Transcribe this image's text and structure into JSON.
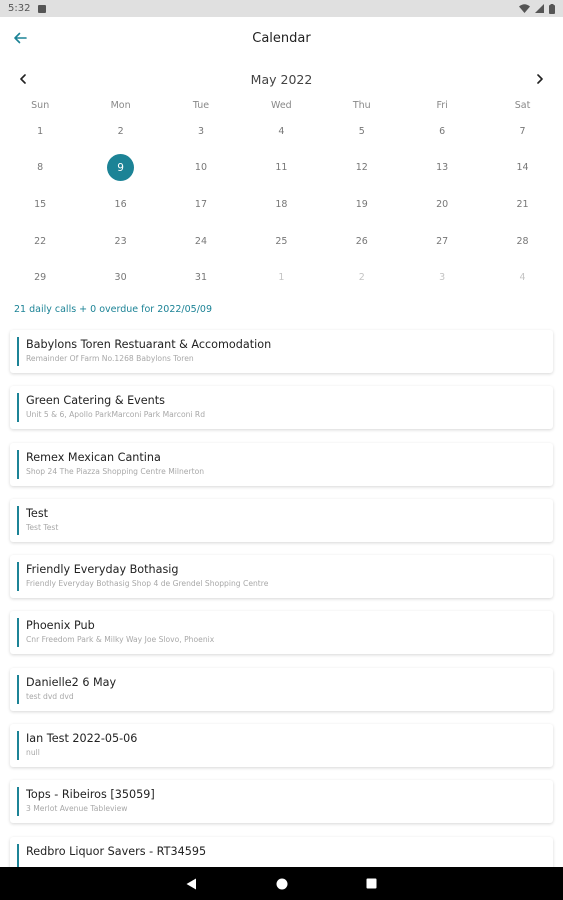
{
  "status_bar": {
    "time": "5:32"
  },
  "header": {
    "title": "Calendar"
  },
  "calendar": {
    "month_label": "May 2022",
    "weekdays": [
      "Sun",
      "Mon",
      "Tue",
      "Wed",
      "Thu",
      "Fri",
      "Sat"
    ],
    "days": [
      {
        "label": "1",
        "current": true
      },
      {
        "label": "2",
        "current": true
      },
      {
        "label": "3",
        "current": true
      },
      {
        "label": "4",
        "current": true
      },
      {
        "label": "5",
        "current": true
      },
      {
        "label": "6",
        "current": true
      },
      {
        "label": "7",
        "current": true
      },
      {
        "label": "8",
        "current": true
      },
      {
        "label": "9",
        "current": true,
        "selected": true
      },
      {
        "label": "10",
        "current": true
      },
      {
        "label": "11",
        "current": true
      },
      {
        "label": "12",
        "current": true
      },
      {
        "label": "13",
        "current": true
      },
      {
        "label": "14",
        "current": true
      },
      {
        "label": "15",
        "current": true
      },
      {
        "label": "16",
        "current": true
      },
      {
        "label": "17",
        "current": true
      },
      {
        "label": "18",
        "current": true
      },
      {
        "label": "19",
        "current": true
      },
      {
        "label": "20",
        "current": true
      },
      {
        "label": "21",
        "current": true
      },
      {
        "label": "22",
        "current": true
      },
      {
        "label": "23",
        "current": true
      },
      {
        "label": "24",
        "current": true
      },
      {
        "label": "25",
        "current": true
      },
      {
        "label": "26",
        "current": true
      },
      {
        "label": "27",
        "current": true
      },
      {
        "label": "28",
        "current": true
      },
      {
        "label": "29",
        "current": true
      },
      {
        "label": "30",
        "current": true
      },
      {
        "label": "31",
        "current": true
      },
      {
        "label": "1",
        "current": false
      },
      {
        "label": "2",
        "current": false
      },
      {
        "label": "3",
        "current": false
      },
      {
        "label": "4",
        "current": false
      }
    ]
  },
  "summary": {
    "text": "21 daily calls + 0 overdue for 2022/05/09"
  },
  "calls": [
    {
      "name": "Babylons Toren Restuarant & Accomodation",
      "address": "Remainder Of Farm No.1268 Babylons Toren"
    },
    {
      "name": "Green Catering & Events",
      "address": "Unit 5 & 6, Apollo ParkMarconi Park Marconi Rd"
    },
    {
      "name": "Remex Mexican Cantina",
      "address": "Shop 24 The Piazza Shopping Centre Milnerton"
    },
    {
      "name": "Test",
      "address": "Test Test"
    },
    {
      "name": "Friendly Everyday Bothasig",
      "address": "Friendly Everyday Bothasig Shop 4 de Grendel Shopping Centre"
    },
    {
      "name": "Phoenix Pub",
      "address": "Cnr Freedom Park & Milky Way Joe Slovo, Phoenix"
    },
    {
      "name": "Danielle2 6 May",
      "address": "test dvd dvd"
    },
    {
      "name": "Ian Test 2022-05-06",
      "address": "null"
    },
    {
      "name": "Tops - Ribeiros [35059]",
      "address": "3 Merlot Avenue Tableview"
    },
    {
      "name": "Redbro Liquor Savers - RT34595",
      "address": ""
    }
  ],
  "colors": {
    "accent": "#1c8396"
  },
  "icons": {
    "back": "arrow-left-icon",
    "prev": "chevron-left-icon",
    "next": "chevron-right-icon"
  }
}
